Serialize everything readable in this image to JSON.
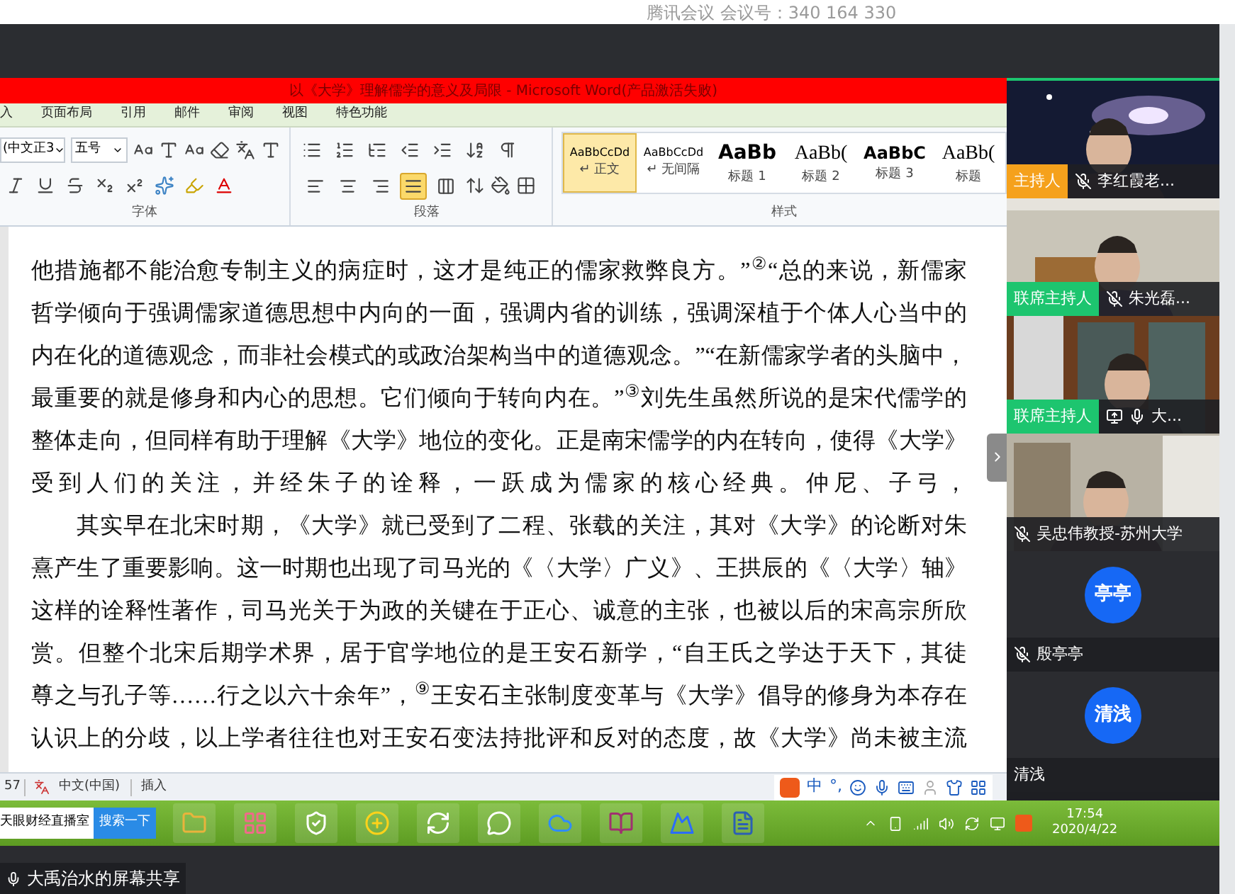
{
  "meeting": {
    "title": "腾讯会议 会议号：340 164 330"
  },
  "word": {
    "title": "以《大学》理解儒学的意义及局限 - Microsoft Word(产品激活失败)",
    "menu_tabs": [
      "入",
      "页面布局",
      "引用",
      "邮件",
      "审阅",
      "视图",
      "特色功能"
    ],
    "ribbon": {
      "font_name": "(中文正3",
      "font_size": "五号",
      "alignment": [
        {
          "kind": "left",
          "selected": false
        },
        {
          "kind": "center",
          "selected": false
        },
        {
          "kind": "right",
          "selected": false
        },
        {
          "kind": "justify",
          "selected": true
        },
        {
          "kind": "distributed",
          "selected": false
        }
      ],
      "styles": [
        {
          "preview": "AaBbCcDd",
          "label": "↵ 正文",
          "kind": "body",
          "selected": true
        },
        {
          "preview": "AaBbCcDd",
          "label": "↵ 无间隔",
          "kind": "body",
          "selected": false
        },
        {
          "preview": "AaBb",
          "label": "标题 1",
          "kind": "heading1",
          "selected": false
        },
        {
          "preview": "AaBb(",
          "label": "标题 2",
          "kind": "heading2",
          "selected": false
        },
        {
          "preview": "AaBbC",
          "label": "标题 3",
          "kind": "heading3",
          "selected": false
        },
        {
          "preview": "AaBb(",
          "label": "标题",
          "kind": "heading2",
          "selected": false
        }
      ],
      "groups": [
        "字体",
        "段落",
        "样式"
      ]
    },
    "document": {
      "paragraphs": [
        {
          "indent": false,
          "lines": [
            "他措施都不能治愈专制主义的病症时，这才是纯正的儒家救弊良方。”$^{②}$“总的来说，新儒家",
            "哲学倾向于强调儒家道德思想中内向的一面，强调内省的训练，强调深植于个体人心当中的",
            "内在化的道德观念，而非社会模式的或政治架构当中的道德观念。”“在新儒家学者的头脑中，",
            "最重要的就是修身和内心的思想。它们倾向于转向内在。”$^{③}$刘先生虽然所说的是宋代儒学的",
            "整体走向，但同样有助于理解《大学》地位的变化。正是南宋儒学的内在转向，使得《大学》",
            "受到人们的关注，并经朱子的诠释，一跃成为儒家的核心经典。仲尼、子弓，"
          ]
        },
        {
          "indent": true,
          "lines": [
            "其实早在北宋时期，《大学》就已受到了二程、张载的关注，其对《大学》的论断对朱",
            "熹产生了重要影响。这一时期也出现了司马光的《〈大学〉广义》、王拱辰的《〈大学〉轴》",
            "这样的诠释性著作，司马光关于为政的关键在于正心、诚意的主张，也被以后的宋高宗所欣",
            "赏。但整个北宋后期学术界，居于官学地位的是王安石新学，“自王氏之学达于天下，其徒",
            "尊之与孔子等……行之以六十余年”，$^{⑨}$王安石主张制度变革与《大学》倡导的修身为本存在",
            "认识上的分歧，以上学者往往也对王安石变法持批评和反对的态度，故《大学》尚未被主流"
          ]
        }
      ]
    },
    "status_bar": {
      "page": "57",
      "language": "中文(中国)",
      "mode": "插入",
      "ime": [
        "中",
        "°,"
      ]
    }
  },
  "taskbar": {
    "search_value": "天眼财经直播室",
    "search_button": "搜索一下",
    "time": "17:54",
    "date": "2020/4/22"
  },
  "participants": [
    {
      "kind": "video",
      "name": "李红霞老...",
      "role": {
        "label": "主持人",
        "color": "#f5a11c"
      },
      "muted": true,
      "sharing": false
    },
    {
      "kind": "video",
      "name": "朱光磊...",
      "role": {
        "label": "联席主持人",
        "color": "#1dc56f"
      },
      "muted": true,
      "sharing": false
    },
    {
      "kind": "video",
      "name": "大...",
      "role": {
        "label": "联席主持人",
        "color": "#1dc56f"
      },
      "muted": false,
      "sharing": true
    },
    {
      "kind": "video",
      "name": "吴忠伟教授-苏州大学",
      "muted": true,
      "sharing": false
    },
    {
      "kind": "avatar",
      "avatar": "亭亭",
      "name": "殷亭亭",
      "muted": true,
      "sharing": false
    },
    {
      "kind": "avatar",
      "avatar": "清浅",
      "name": "清浅",
      "sharing": false
    }
  ],
  "share_label": "大禹治水的屏幕共享"
}
